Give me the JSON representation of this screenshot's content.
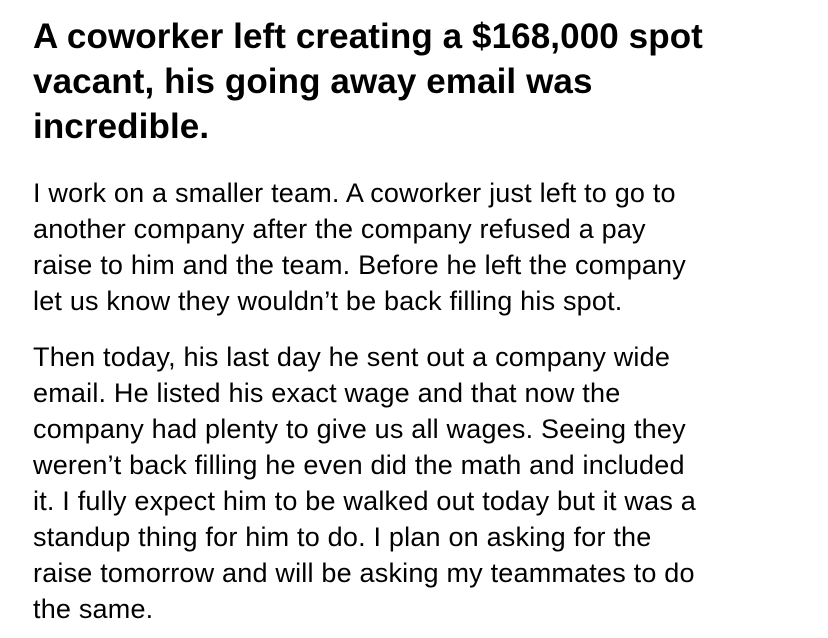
{
  "post": {
    "title": "A coworker left creating a $168,000 spot\nvacant, his going away email was\nincredible.",
    "paragraphs": [
      "I work on a smaller team.  A coworker just left to go to\nanother company after the company refused a pay\nraise to him and the team.  Before he left the company\nlet us know they wouldn’t be back filling his spot.",
      "Then today, his last day he sent out a company wide\nemail.  He listed his exact wage and that now the\ncompany had plenty to give us all wages.  Seeing they\nweren’t back filling he even did the math and included\nit.  I fully expect him to be walked out today but it was a\nstandup thing for him to do.  I plan on asking for the\nraise tomorrow and will be asking my teammates to do\nthe same."
    ]
  }
}
